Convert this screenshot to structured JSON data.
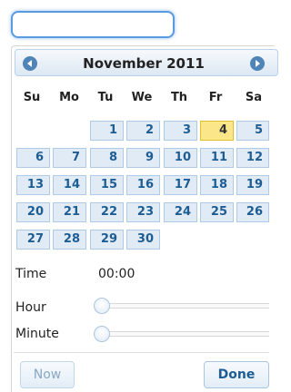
{
  "input": {
    "value": ""
  },
  "calendar": {
    "month_title": "November 2011",
    "weekdays": [
      "Su",
      "Mo",
      "Tu",
      "We",
      "Th",
      "Fr",
      "Sa"
    ],
    "days": [
      "1",
      "2",
      "3",
      "4",
      "5",
      "6",
      "7",
      "8",
      "9",
      "10",
      "11",
      "12",
      "13",
      "14",
      "15",
      "16",
      "17",
      "18",
      "19",
      "20",
      "21",
      "22",
      "23",
      "24",
      "25",
      "26",
      "27",
      "28",
      "29",
      "30"
    ],
    "today": "4"
  },
  "time": {
    "label": "Time",
    "value": "00:00",
    "hour_label": "Hour",
    "minute_label": "Minute",
    "hour_value": 0,
    "minute_value": 0
  },
  "buttons": {
    "now": "Now",
    "done": "Done"
  },
  "colors": {
    "accent": "#1d5d94",
    "highlight": "#fbe68a",
    "cell_bg": "#e1ebf5",
    "nav": "#4f84b8"
  }
}
